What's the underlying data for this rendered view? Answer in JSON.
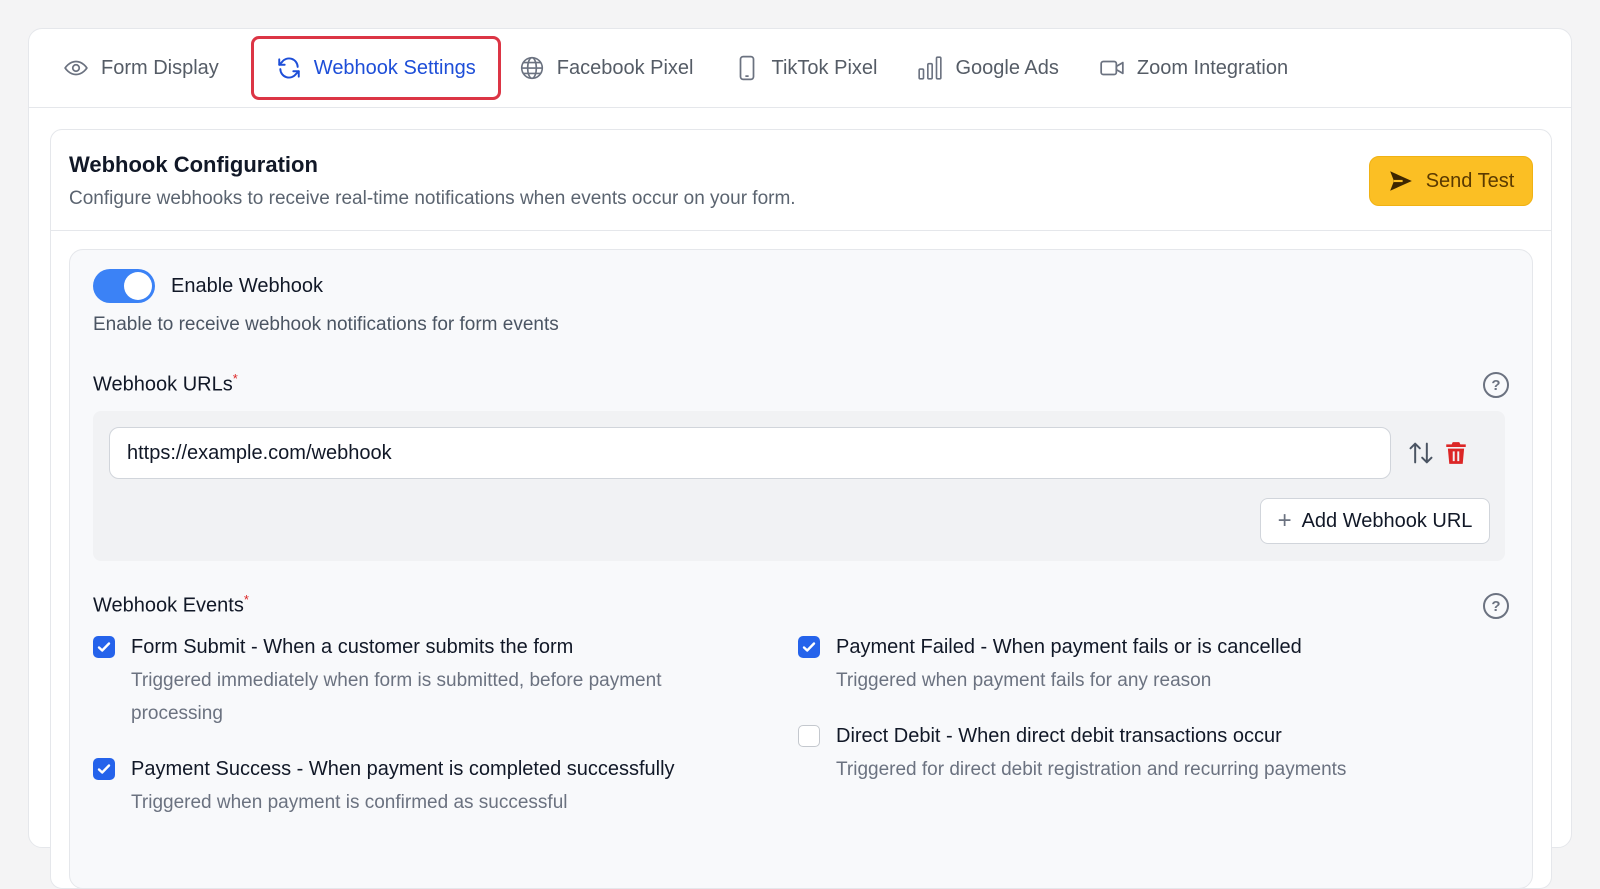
{
  "tabs": [
    {
      "label": "Form Display",
      "icon": "eye-icon",
      "active": false
    },
    {
      "label": "Webhook Settings",
      "icon": "refresh-icon",
      "active": true
    },
    {
      "label": "Facebook Pixel",
      "icon": "globe-icon",
      "active": false
    },
    {
      "label": "TikTok Pixel",
      "icon": "phone-icon",
      "active": false
    },
    {
      "label": "Google Ads",
      "icon": "bar-chart-icon",
      "active": false
    },
    {
      "label": "Zoom Integration",
      "icon": "video-icon",
      "active": false
    }
  ],
  "card": {
    "title": "Webhook Configuration",
    "description": "Configure webhooks to receive real-time notifications when events occur on your form.",
    "send_test_label": "Send Test"
  },
  "toggle": {
    "label": "Enable Webhook",
    "help": "Enable to receive webhook notifications for form events",
    "enabled": true
  },
  "urls": {
    "label": "Webhook URLs",
    "required_mark": "*",
    "value": "https://example.com/webhook",
    "add_label": "Add Webhook URL"
  },
  "events": {
    "label": "Webhook Events",
    "required_mark": "*",
    "items": [
      {
        "title": "Form Submit - When a customer submits the form",
        "desc_line1": "Triggered immediately when form is submitted, before payment",
        "desc_line2": "processing",
        "checked": true
      },
      {
        "title": "Payment Success - When payment is completed successfully",
        "desc_line1": "Triggered when payment is confirmed as successful",
        "checked": true
      },
      {
        "title": "Payment Failed - When payment fails or is cancelled",
        "desc_line1": "Triggered when payment fails for any reason",
        "checked": true
      },
      {
        "title": "Direct Debit - When direct debit transactions occur",
        "desc_line1": "Triggered for direct debit registration and recurring payments",
        "checked": false
      }
    ]
  },
  "colors": {
    "accent": "#2563eb",
    "active_tab_border": "#dc3545",
    "send_test_bg": "#fbbf24",
    "danger": "#dc2626"
  }
}
